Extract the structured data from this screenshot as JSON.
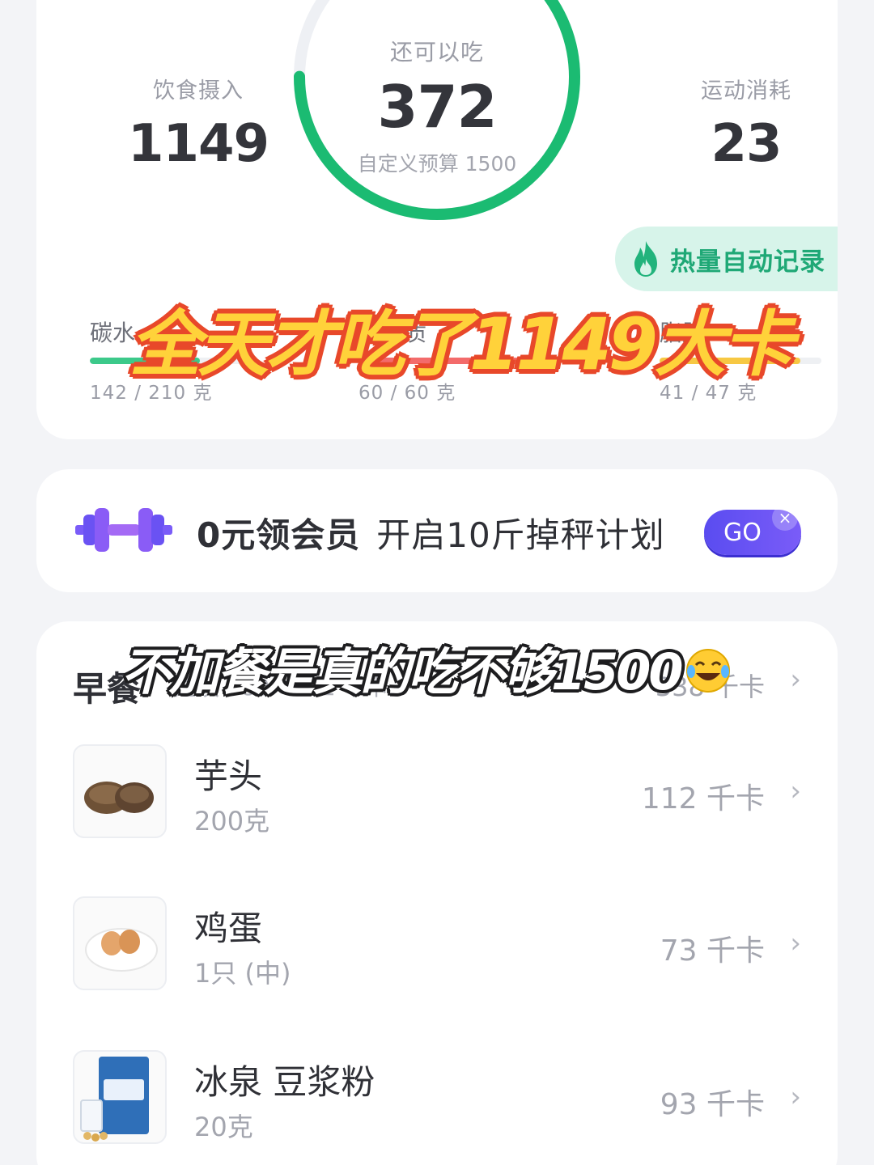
{
  "summary": {
    "intake_label": "饮食摄入",
    "intake_value": "1149",
    "remaining_label": "还可以吃",
    "remaining_value": "372",
    "budget_text": "自定义预算 1500",
    "burn_label": "运动消耗",
    "burn_value": "23",
    "ring_progress": 0.75,
    "auto_record_label": "热量自动记录",
    "macros": [
      {
        "label": "碳水",
        "amount": "142 / 210 克",
        "ratio": 0.68,
        "color": "#3cc98a"
      },
      {
        "label": "蛋白质",
        "amount": "60 / 60 克",
        "ratio": 1.0,
        "color": "#f36b6b"
      },
      {
        "label": "脂肪",
        "amount": "41 / 47 克",
        "ratio": 0.87,
        "color": "#f7c843"
      }
    ]
  },
  "overlay_caption_top": "全天才吃了1149大卡",
  "promo": {
    "bold_text": "0元领会员",
    "text": "开启10斤掉秤计划",
    "button_label": "GO",
    "close_glyph": "×"
  },
  "meal": {
    "title": "早餐",
    "suggest": "建议 380 - 532 千卡",
    "total": "338 千卡",
    "items": [
      {
        "name": "芋头",
        "amount": "200克",
        "kcal": "112 千卡",
        "icon": "taro-image"
      },
      {
        "name": "鸡蛋",
        "amount": "1只 (中)",
        "kcal": "73 千卡",
        "icon": "egg-image"
      },
      {
        "name": "冰泉 豆浆粉",
        "amount": "20克",
        "kcal": "93 千卡",
        "icon": "soy-milk-powder-image"
      }
    ]
  },
  "overlay_caption_bottom": "不加餐是真的吃不够1500",
  "colors": {
    "ring_green": "#1bbb72",
    "ring_track": "#eef0f4",
    "accent_purple": "#6a52f3"
  }
}
